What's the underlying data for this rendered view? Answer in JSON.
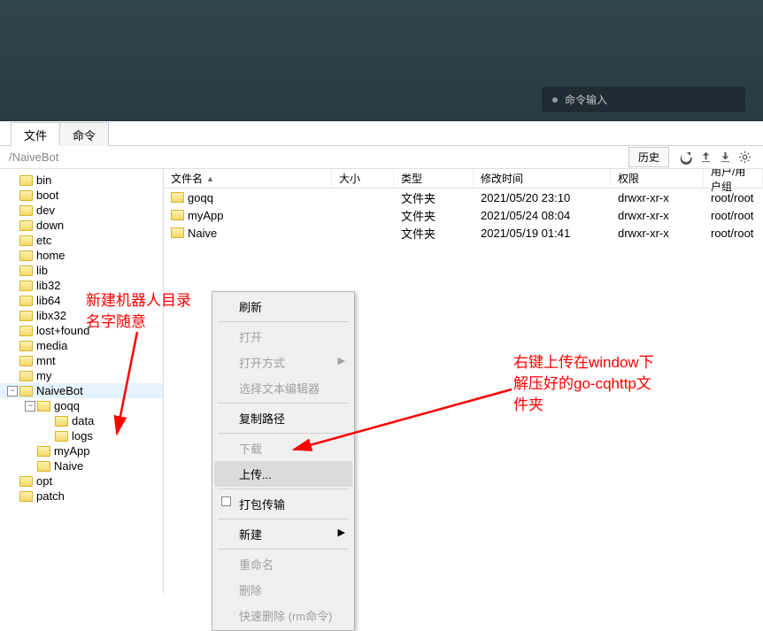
{
  "terminal": {
    "cmd_placeholder": "命令输入"
  },
  "tabs": {
    "file": "文件",
    "command": "命令"
  },
  "pathbar": {
    "path": "/NaiveBot",
    "history": "历史"
  },
  "tree": [
    {
      "name": "bin",
      "depth": 1
    },
    {
      "name": "boot",
      "depth": 1
    },
    {
      "name": "dev",
      "depth": 1
    },
    {
      "name": "down",
      "depth": 1
    },
    {
      "name": "etc",
      "depth": 1
    },
    {
      "name": "home",
      "depth": 1
    },
    {
      "name": "lib",
      "depth": 1
    },
    {
      "name": "lib32",
      "depth": 1
    },
    {
      "name": "lib64",
      "depth": 1
    },
    {
      "name": "libx32",
      "depth": 1
    },
    {
      "name": "lost+found",
      "depth": 1
    },
    {
      "name": "media",
      "depth": 1
    },
    {
      "name": "mnt",
      "depth": 1
    },
    {
      "name": "my",
      "depth": 1
    },
    {
      "name": "NaiveBot",
      "depth": 1,
      "selected": true,
      "expander": "-"
    },
    {
      "name": "goqq",
      "depth": 2,
      "expander": "-"
    },
    {
      "name": "data",
      "depth": 3
    },
    {
      "name": "logs",
      "depth": 3
    },
    {
      "name": "myApp",
      "depth": 2
    },
    {
      "name": "Naive",
      "depth": 2
    },
    {
      "name": "opt",
      "depth": 1
    },
    {
      "name": "patch",
      "depth": 1
    }
  ],
  "list": {
    "headers": {
      "name": "文件名",
      "size": "大小",
      "type": "类型",
      "mtime": "修改时间",
      "perm": "权限",
      "owner": "用户/用户组"
    },
    "rows": [
      {
        "name": "goqq",
        "type": "文件夹",
        "mtime": "2021/05/20 23:10",
        "perm": "drwxr-xr-x",
        "owner": "root/root"
      },
      {
        "name": "myApp",
        "type": "文件夹",
        "mtime": "2021/05/24 08:04",
        "perm": "drwxr-xr-x",
        "owner": "root/root"
      },
      {
        "name": "Naive",
        "type": "文件夹",
        "mtime": "2021/05/19 01:41",
        "perm": "drwxr-xr-x",
        "owner": "root/root"
      }
    ]
  },
  "ctx": {
    "refresh": "刷新",
    "open": "打开",
    "open_with": "打开方式",
    "select_editor": "选择文本编辑器",
    "copy_path": "复制路径",
    "download": "下载",
    "upload": "上传...",
    "pack_transfer": "打包传输",
    "new": "新建",
    "rename": "重命名",
    "delete": "删除",
    "fast_delete": "快速删除 (rm命令)"
  },
  "annotations": {
    "a1_l1": "新建机器人目录",
    "a1_l2": "名字随意",
    "a2_l1": "右键上传在window下",
    "a2_l2": "解压好的go-cqhttp文",
    "a2_l3": "件夹"
  }
}
